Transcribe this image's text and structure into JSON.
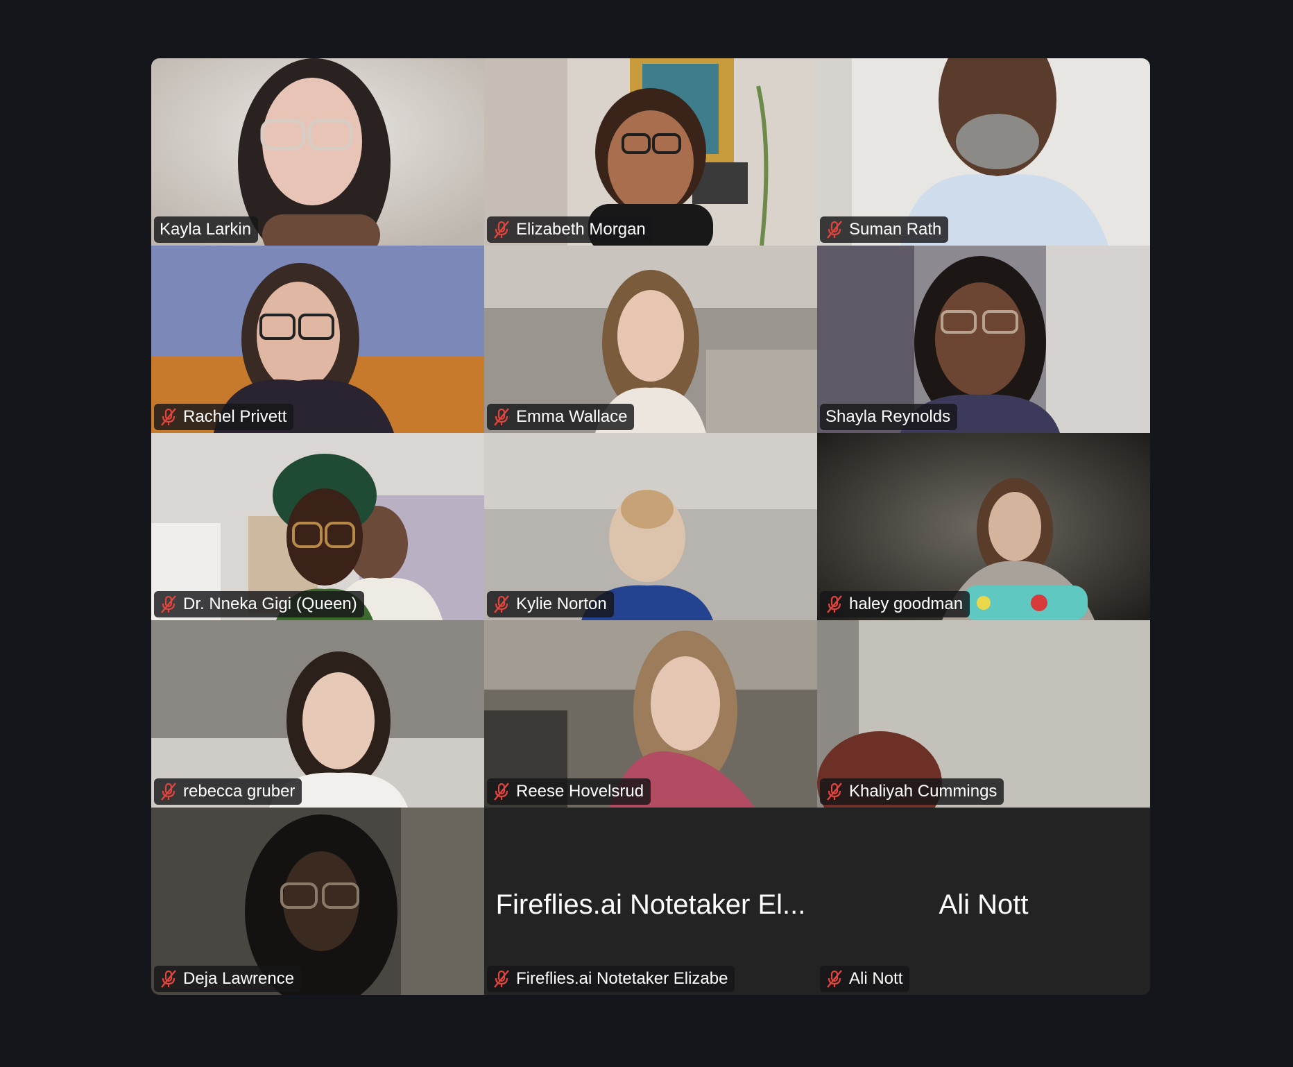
{
  "meeting": {
    "background_color": "#14161b",
    "active_speaker_border_color": "#5fcd5f",
    "muted_icon_color": "#e0453e",
    "participants": [
      {
        "name": "Kayla Larkin",
        "muted": false,
        "active": false,
        "video": true
      },
      {
        "name": "Elizabeth Morgan",
        "muted": true,
        "active": false,
        "video": true
      },
      {
        "name": "Suman Rath",
        "muted": true,
        "active": false,
        "video": true
      },
      {
        "name": "Rachel Privett",
        "muted": true,
        "active": false,
        "video": true
      },
      {
        "name": "Emma Wallace",
        "muted": true,
        "active": false,
        "video": true
      },
      {
        "name": "Shayla Reynolds",
        "muted": false,
        "active": true,
        "video": true
      },
      {
        "name": "Dr. Nneka Gigi (Queen)",
        "muted": true,
        "active": false,
        "video": true
      },
      {
        "name": "Kylie Norton",
        "muted": true,
        "active": false,
        "video": true
      },
      {
        "name": "haley goodman",
        "muted": true,
        "active": false,
        "video": true
      },
      {
        "name": "rebecca gruber",
        "muted": true,
        "active": false,
        "video": true
      },
      {
        "name": "Reese Hovelsrud",
        "muted": true,
        "active": false,
        "video": true
      },
      {
        "name": "Khaliyah Cummings",
        "muted": true,
        "active": false,
        "video": true
      },
      {
        "name": "Deja Lawrence",
        "muted": true,
        "active": false,
        "video": true
      },
      {
        "name": "Fireflies.ai Notetaker Elizabe",
        "display_name": "Fireflies.ai Notetaker El...",
        "muted": true,
        "active": false,
        "video": false
      },
      {
        "name": "Ali Nott",
        "display_name": "Ali Nott",
        "muted": true,
        "active": false,
        "video": false
      }
    ]
  }
}
